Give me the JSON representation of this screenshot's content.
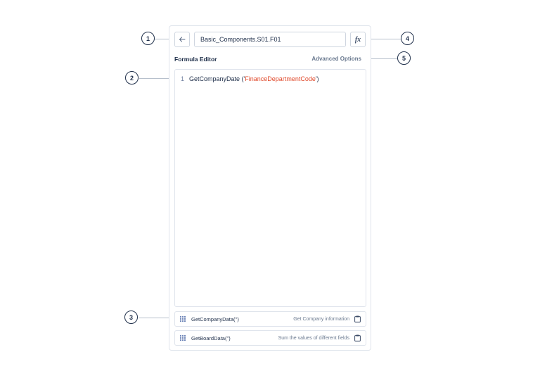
{
  "header": {
    "formula_name": "Basic_Components.S01.F01",
    "fx_label": "fx"
  },
  "editor": {
    "title": "Formula Editor",
    "advanced_options": "Advanced Options",
    "lines": [
      {
        "number": "1",
        "function": "GetCompanyDate",
        "open": " ('",
        "argument": "FinanceDepartmentCode",
        "close": "')"
      }
    ]
  },
  "suggestions": [
    {
      "name": "GetCompanyData('')",
      "description": "Get Company information"
    },
    {
      "name": "GetBoardData('')",
      "description": "Sum the values of different fields"
    }
  ],
  "callouts": [
    "1",
    "2",
    "3",
    "4",
    "5"
  ],
  "colors": {
    "text": "#1f2f4a",
    "string_literal": "#e0482a",
    "border": "#dfe4ec",
    "muted": "#6b7a90"
  }
}
